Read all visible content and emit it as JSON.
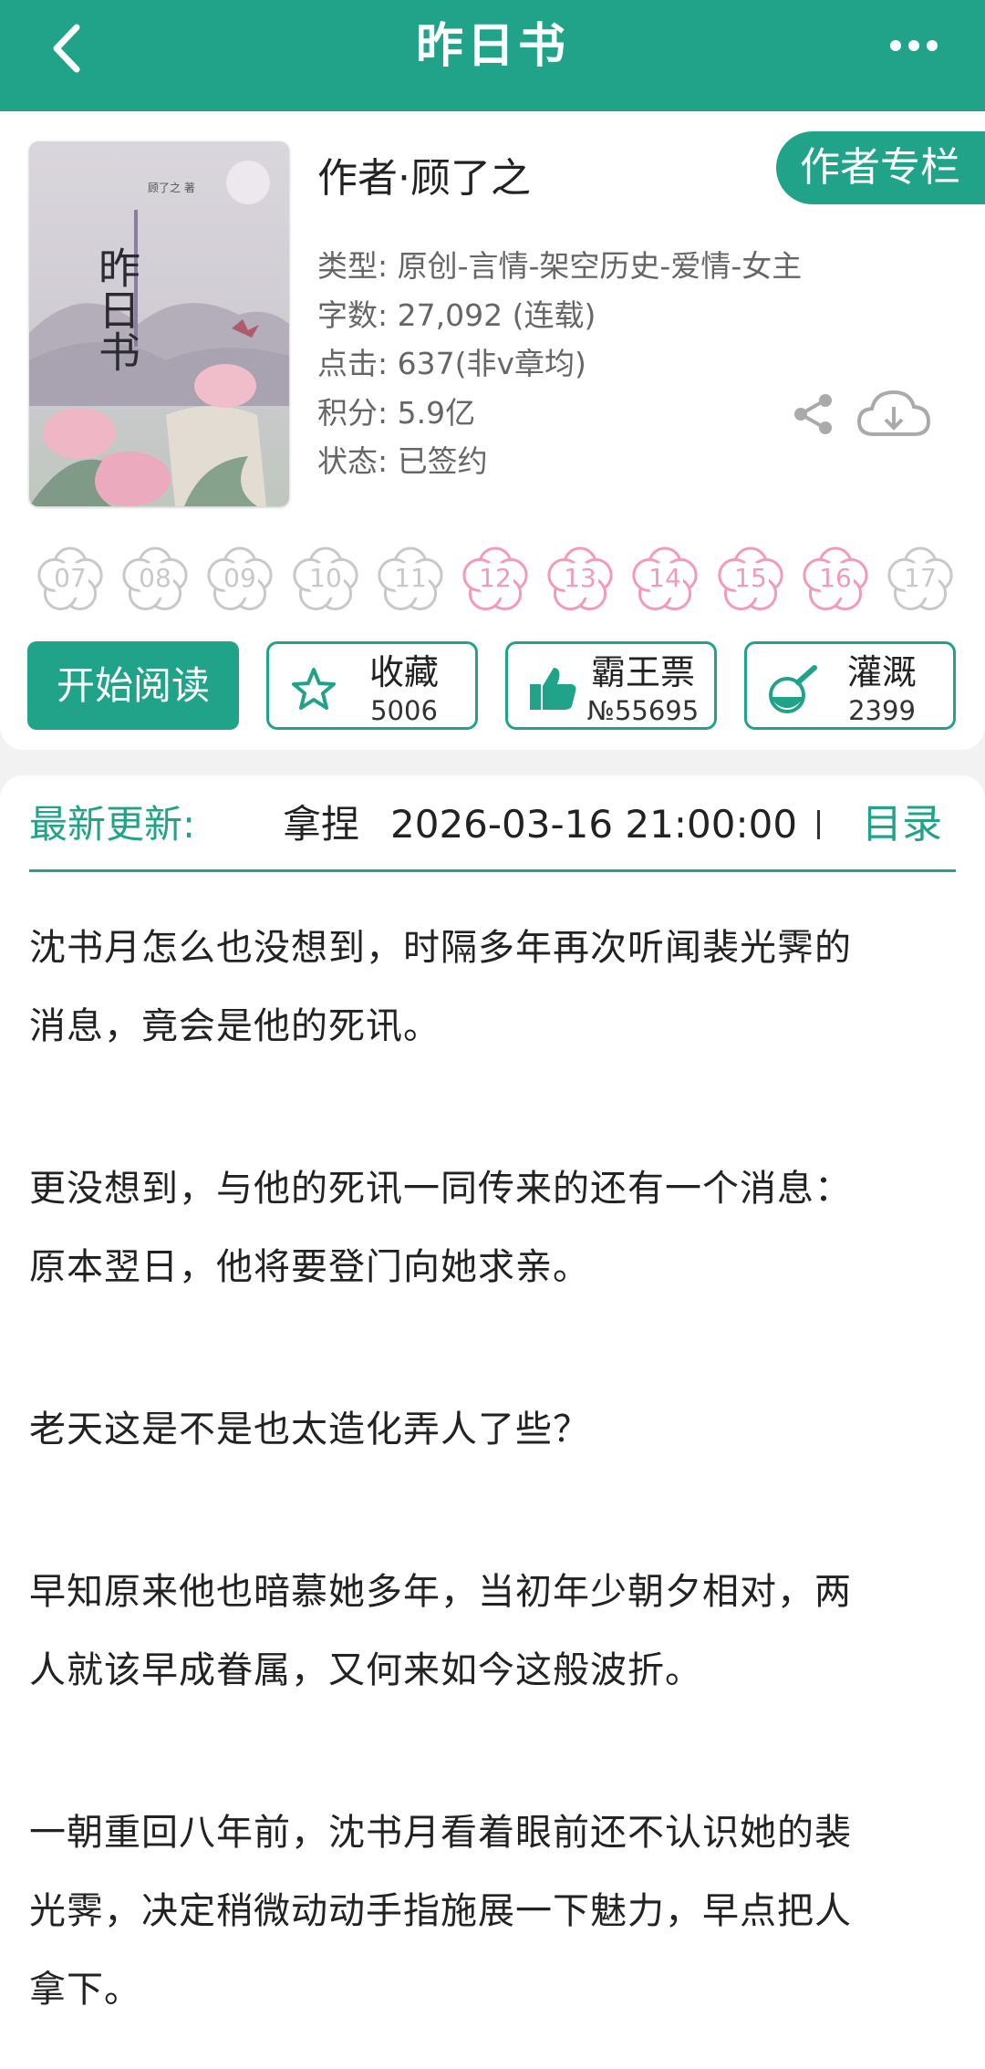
{
  "header": {
    "title": "昨日书",
    "back_icon": "chevron-left-icon",
    "more_icon": "more-dots-icon"
  },
  "book": {
    "cover_author_mark": "顾了之 著",
    "cover_title": "昨日书",
    "author_line": "作者·顾了之",
    "author_column_button": "作者专栏",
    "type_line": "类型: 原创-言情-架空历史-爱情-女主",
    "words_line": "字数: 27,092 (连载)",
    "clicks_line": "点击: 637(非v章均)",
    "score_line": "积分: 5.9亿",
    "status_line": "状态: 已签约"
  },
  "rating": {
    "labels": [
      "07",
      "08",
      "09",
      "10",
      "11",
      "12",
      "13",
      "14",
      "15",
      "16",
      "17"
    ],
    "highlighted": [
      false,
      false,
      false,
      false,
      false,
      true,
      true,
      true,
      true,
      true,
      false
    ]
  },
  "actions": {
    "start_read": "开始阅读",
    "favorite_label": "收藏",
    "favorite_count": "5006",
    "ticket_label": "霸王票",
    "ticket_count": "№55695",
    "nutrient_label": "灌溉",
    "nutrient_count": "2399"
  },
  "update": {
    "label": "最新更新:",
    "chapter": "拿捏",
    "time": "2026-03-16 21:00:00",
    "toc": "目录"
  },
  "synopsis": {
    "p1_l1": "沈书月怎么也没想到，时隔多年再次听闻裴光霁的",
    "p1_l2": "消息，竟会是他的死讯。",
    "p2_l1": "更没想到，与他的死讯一同传来的还有一个消息：",
    "p2_l2": "原本翌日，他将要登门向她求亲。",
    "p3_l1": "老天这是不是也太造化弄人了些？",
    "p4_l1": "早知原来他也暗慕她多年，当初年少朝夕相对，两",
    "p4_l2": "人就该早成眷属，又何来如今这般波折。",
    "p5_l1": "一朝重回八年前，沈书月看着眼前还不认识她的裴",
    "p5_l2": "光霁，决定稍微动动手指施展一下魅力，早点把人",
    "p5_l3": "拿下。"
  },
  "colors": {
    "accent": "#21a38a",
    "flower_gray": "#c8c8c8",
    "flower_pink": "#f29bb8"
  }
}
